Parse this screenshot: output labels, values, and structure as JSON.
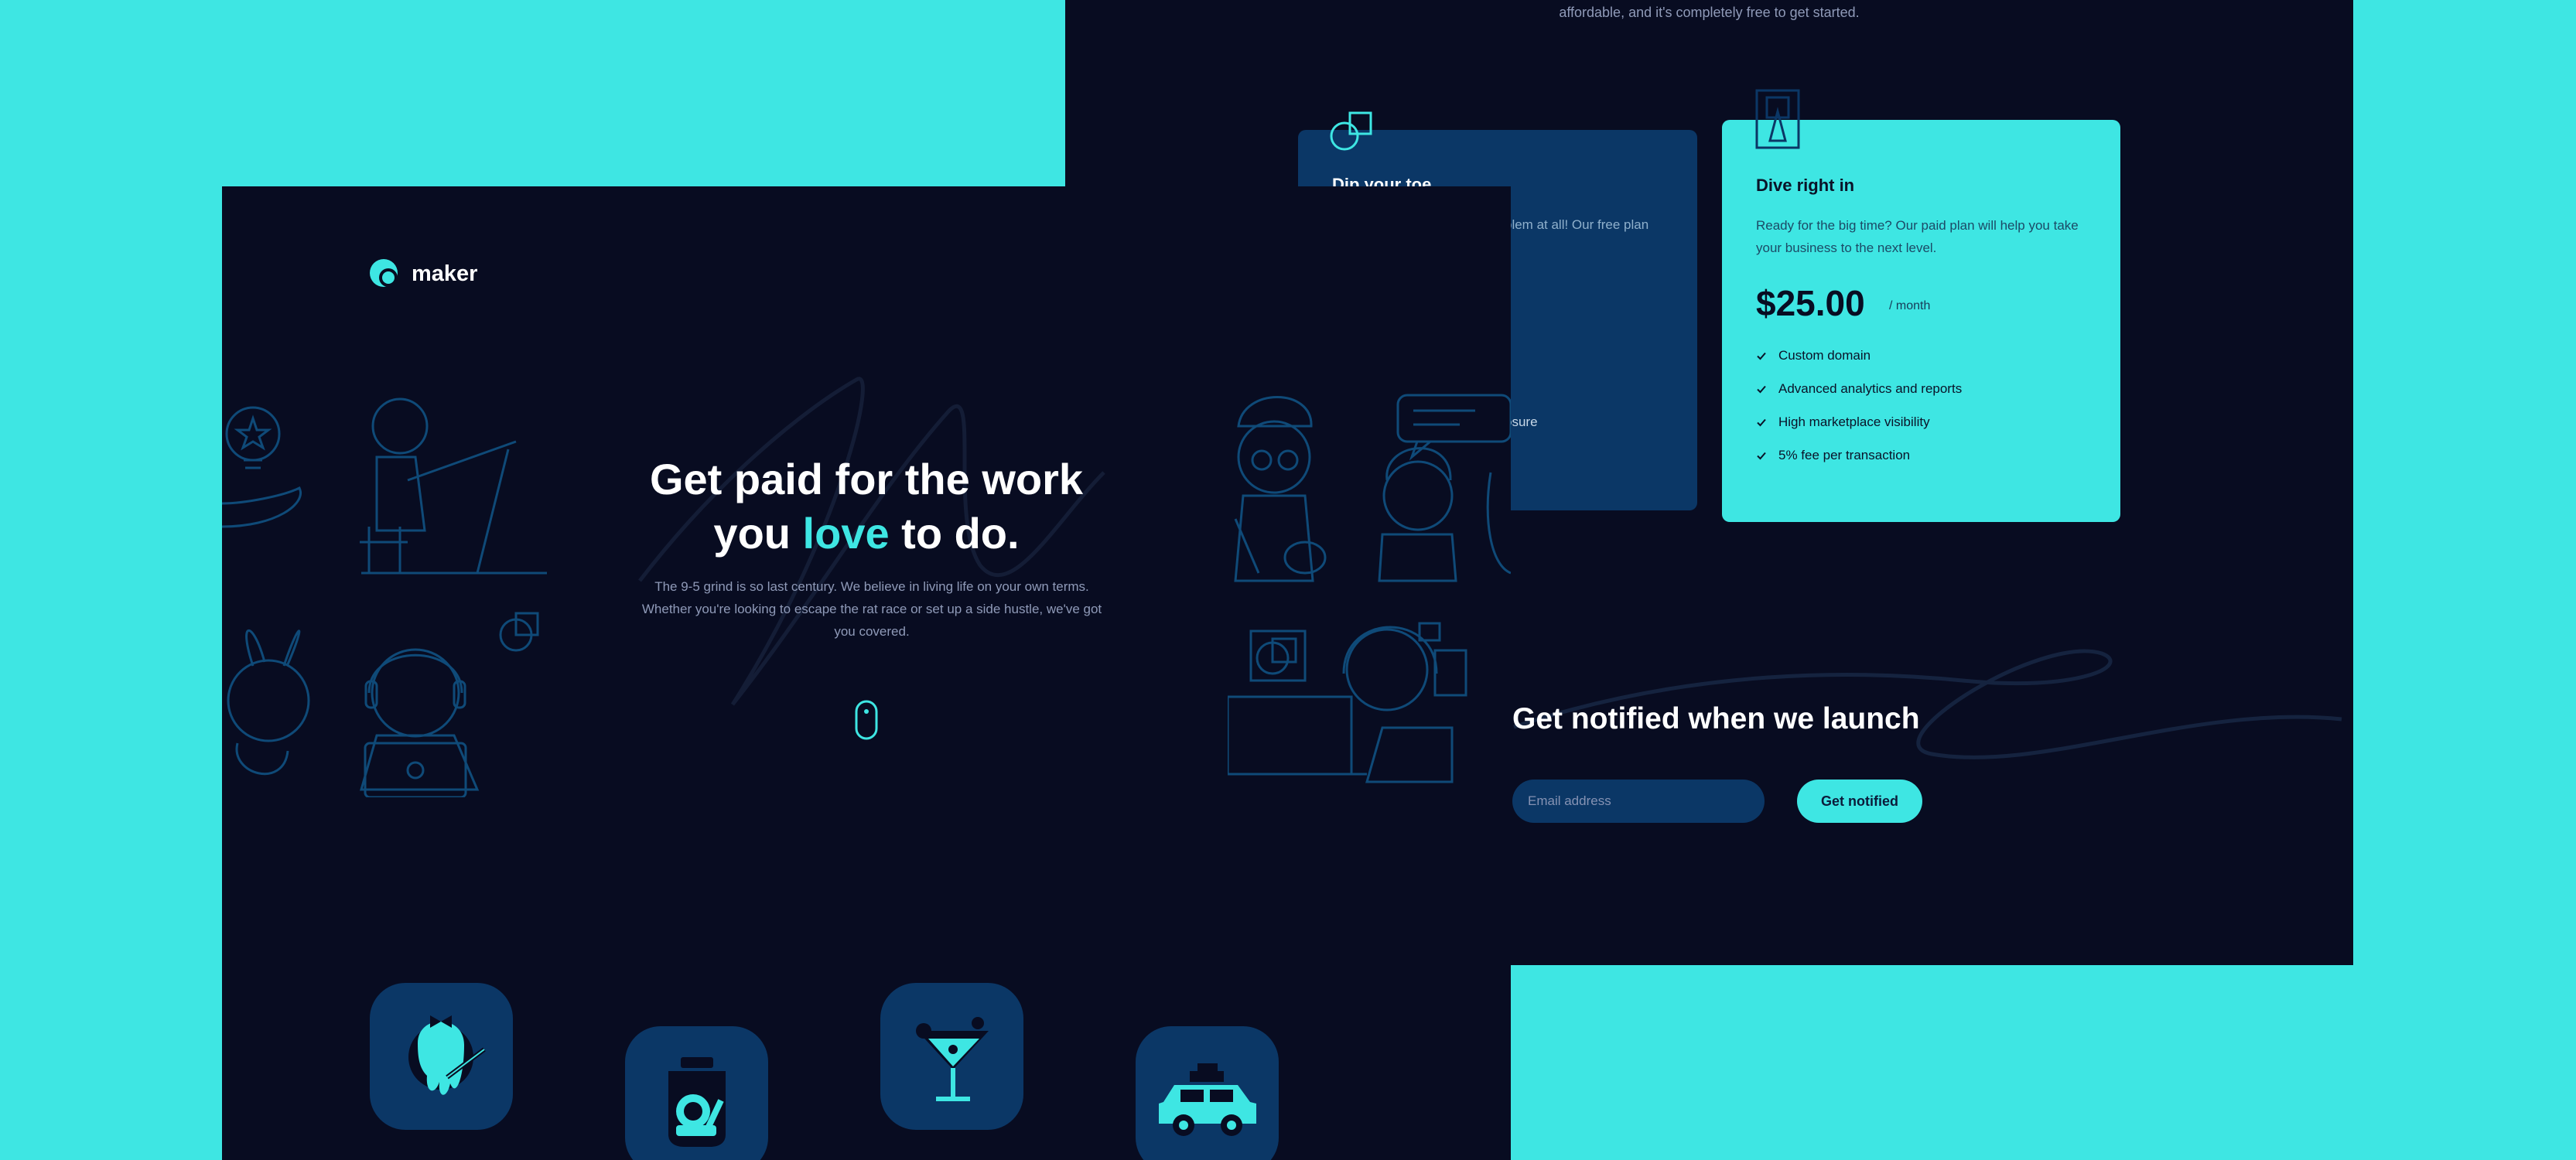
{
  "back": {
    "intro_text": "affordable, and it's completely free to get started.",
    "free_card": {
      "title": "Dip your toe",
      "desc": "blem at all! Our free plan",
      "feature_fragment": "osure"
    },
    "paid_card": {
      "title": "Dive right in",
      "desc": "Ready for the big time? Our paid plan will help you take your business to the next level.",
      "price": "$25.00",
      "period": "/ month",
      "features": [
        "Custom domain",
        "Advanced analytics and reports",
        "High marketplace visibility",
        "5% fee per transaction"
      ]
    },
    "notify": {
      "title": "Get notified when we launch",
      "email_placeholder": "Email address",
      "button_label": "Get notified"
    }
  },
  "front": {
    "logo_text": "maker",
    "hero": {
      "title_line1": "Get paid for the work",
      "title_you": "you",
      "title_highlight": "love",
      "title_end": "to do.",
      "description": "The 9-5 grind is so last century. We believe in living life on your own terms. Whether you're looking to escape the rat race or set up a side hustle, we've got you covered."
    },
    "app_tiles": [
      "paint-tile-icon",
      "money-jar-tile-icon",
      "cocktail-tile-icon",
      "car-tile-icon"
    ]
  },
  "colors": {
    "background": "#3ee6e3",
    "panel": "#080c21",
    "accent": "#3ee6e3",
    "card_dark": "#0b3766",
    "illustration_stroke": "#0f4a78"
  }
}
